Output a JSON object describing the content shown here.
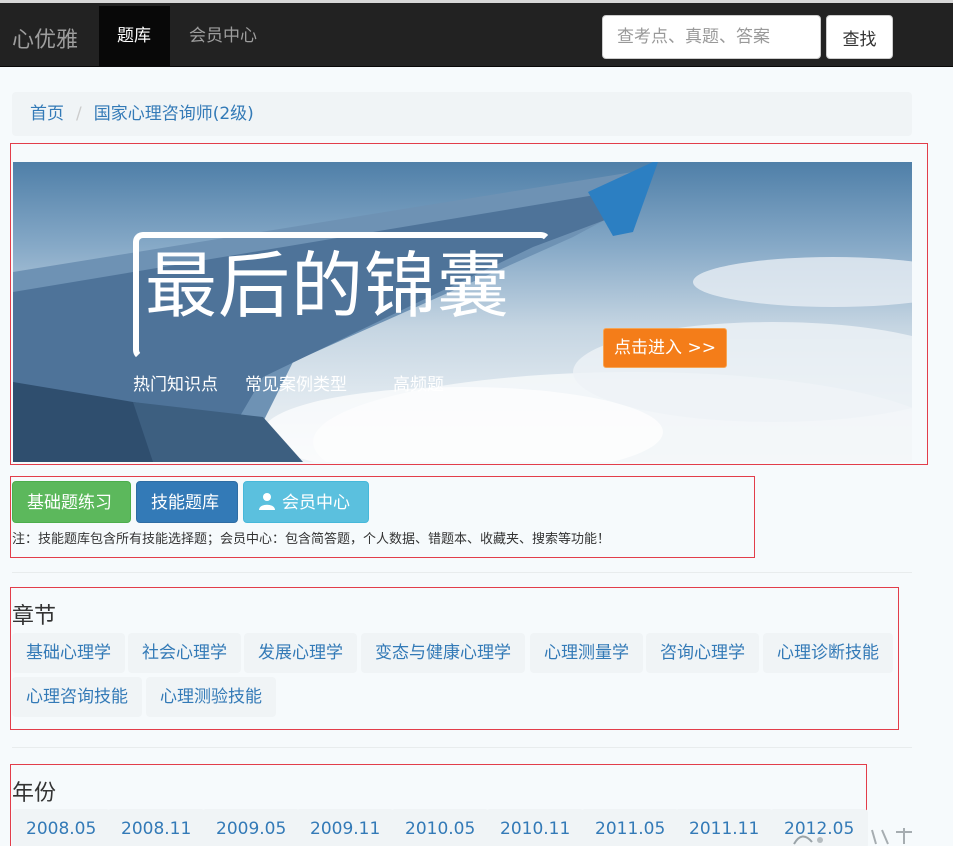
{
  "navbar": {
    "brand": "心优雅",
    "items": [
      {
        "label": "题库",
        "active": true
      },
      {
        "label": "会员中心",
        "active": false
      }
    ],
    "search_placeholder": "查考点、真题、答案",
    "search_button": "查找"
  },
  "breadcrumb": {
    "home": "首页",
    "current": "国家心理咨询师(2级)"
  },
  "banner": {
    "title": "最后的锦囊",
    "tags": [
      "热门知识点",
      "常见案例类型",
      "高频题"
    ],
    "enter_button": "点击进入 >>"
  },
  "actions": {
    "basic": "基础题练习",
    "skill": "技能题库",
    "member": "会员中心",
    "note": "注：技能题库包含所有技能选择题；会员中心：包含简答题，个人数据、错题本、收藏夹、搜索等功能！"
  },
  "chapters": {
    "title": "章节",
    "items": [
      "基础心理学",
      "社会心理学",
      "发展心理学",
      "变态与健康心理学",
      "心理测量学",
      "咨询心理学",
      "心理诊断技能",
      "心理咨询技能",
      "心理测验技能"
    ]
  },
  "years": {
    "title": "年份",
    "items": [
      "2008.05",
      "2008.11",
      "2009.05",
      "2009.11",
      "2010.05",
      "2010.11",
      "2011.05",
      "2011.11",
      "2012.05"
    ]
  },
  "colors": {
    "navbar": "#222222",
    "link": "#337ab7",
    "green": "#5cb85c",
    "blue": "#337ab7",
    "cyan": "#5bc0de",
    "orange": "#f47d19",
    "annotation_red": "#e23d4a"
  }
}
